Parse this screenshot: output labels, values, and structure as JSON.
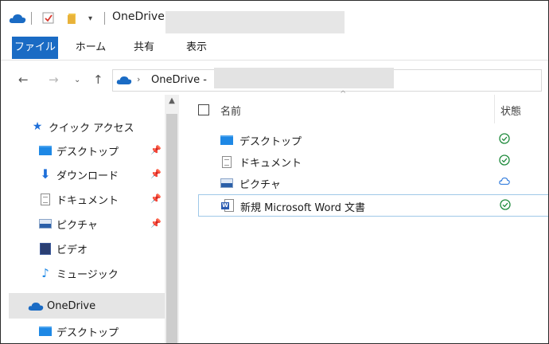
{
  "window": {
    "title": "OneDrive"
  },
  "ribbon": {
    "tabs": [
      "ファイル",
      "ホーム",
      "共有",
      "表示"
    ]
  },
  "address": {
    "path_root": "OneDrive -"
  },
  "nav_pane": {
    "quick_access_label": "クイック アクセス",
    "quick_items": [
      {
        "label": "デスクトップ",
        "icon": "desktop-folder-icon",
        "pinned": true
      },
      {
        "label": "ダウンロード",
        "icon": "download-icon",
        "pinned": true
      },
      {
        "label": "ドキュメント",
        "icon": "documents-icon",
        "pinned": true
      },
      {
        "label": "ピクチャ",
        "icon": "pictures-icon",
        "pinned": true
      },
      {
        "label": "ビデオ",
        "icon": "videos-icon",
        "pinned": false
      },
      {
        "label": "ミュージック",
        "icon": "music-icon",
        "pinned": false
      }
    ],
    "onedrive_label": "OneDrive",
    "onedrive_children": [
      {
        "label": "デスクトップ",
        "icon": "desktop-folder-icon"
      }
    ]
  },
  "file_list": {
    "columns": {
      "name": "名前",
      "status": "状態"
    },
    "rows": [
      {
        "name": "デスクトップ",
        "icon": "desktop-folder-icon",
        "status": "synced"
      },
      {
        "name": "ドキュメント",
        "icon": "documents-icon",
        "status": "synced"
      },
      {
        "name": "ピクチャ",
        "icon": "pictures-icon",
        "status": "cloud"
      },
      {
        "name": "新規 Microsoft Word 文書",
        "icon": "word-document-icon",
        "status": "synced"
      }
    ]
  },
  "colors": {
    "accent": "#1a6bc4",
    "synced_green": "#1f8a3c",
    "cloud_blue": "#1e6fd9"
  }
}
